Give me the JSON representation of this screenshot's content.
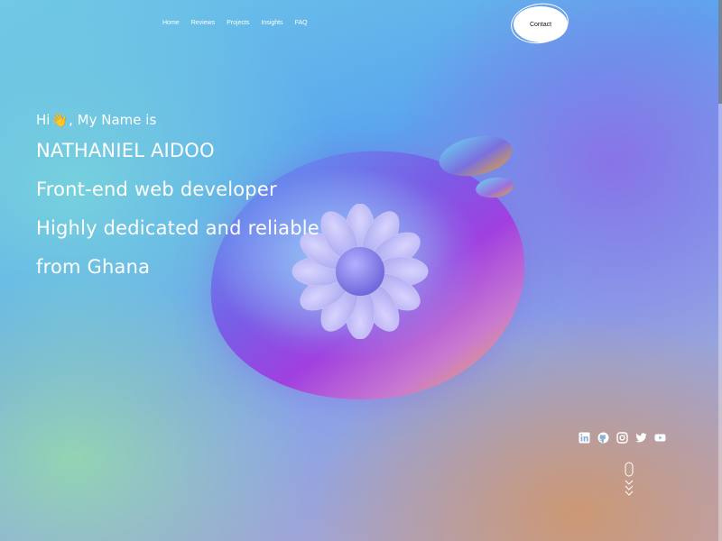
{
  "nav": {
    "items": [
      "Home",
      "Reviews",
      "Projects",
      "Insights",
      "FAQ"
    ],
    "contact_label": "Contact"
  },
  "hero": {
    "greeting_pre": "Hi",
    "greeting_emoji": "👋",
    "greeting_post": ", My Name is",
    "name": "NATHANIEL AIDOO",
    "role": "Front-end web developer",
    "tagline": "Highly dedicated and reliable",
    "origin": "from Ghana"
  },
  "social": {
    "icons": [
      "linkedin-icon",
      "github-icon",
      "instagram-icon",
      "twitter-icon",
      "youtube-icon"
    ]
  },
  "colors": {
    "text": "#ffffff",
    "button_bg": "#ffffff",
    "button_text": "#111111"
  }
}
